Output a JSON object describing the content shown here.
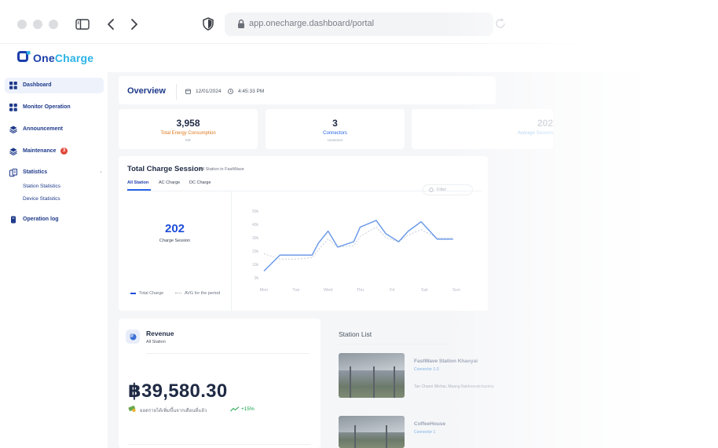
{
  "browser": {
    "url": "app.onecharge.dashboard/portal",
    "icons": [
      "sidebar-toggle-icon",
      "back-chevron-icon",
      "forward-chevron-icon",
      "shield-icon",
      "lock-icon",
      "reload-icon"
    ]
  },
  "brand": {
    "name_part1": "One",
    "name_part2": "Charge",
    "accent": "#1c3faa",
    "accent2": "#2bb3e6"
  },
  "sidebar": {
    "items": [
      {
        "label": "Dashboard",
        "icon": "grid-icon"
      },
      {
        "label": "Monitor Operation",
        "icon": "grid-icon"
      },
      {
        "label": "Announcement",
        "icon": "layers-icon"
      },
      {
        "label": "Maintenance",
        "icon": "layers-icon",
        "badge": "3"
      },
      {
        "label": "Statistics",
        "icon": "stats-icon"
      },
      {
        "label": "Operation log",
        "icon": "doc-icon"
      }
    ],
    "statistics_sub": [
      "Station Statistics",
      "Device Statistics"
    ]
  },
  "overview": {
    "title": "Overview",
    "date": "12/01/2024",
    "time": "4:45:33 PM"
  },
  "stats": [
    {
      "value": "3,958",
      "label": "Total Energy Consumption",
      "unit": "kW",
      "color": "#e07a1f"
    },
    {
      "value": "3",
      "label": "Connectors",
      "unit": "connector",
      "color": "#2563eb"
    },
    {
      "value": "202",
      "label": "Average Session",
      "unit": "",
      "color": "#7fb2e6"
    }
  ],
  "sessions": {
    "title": "Total Charge Session",
    "subtitle": "All Station in FastWave",
    "tabs": [
      "All Station",
      "AC Charge",
      "DC Charge"
    ],
    "filter_label": "Filter",
    "count": "202",
    "count_label": "Charge Session",
    "legend_total": "Total Charge",
    "legend_avg": "AVG for the period"
  },
  "chart_data": {
    "type": "line",
    "categories": [
      "Mon",
      "Tue",
      "Wed",
      "Thu",
      "Fri",
      "Sat",
      "Sun"
    ],
    "y_ticks": [
      "50k",
      "40k",
      "30k",
      "20k",
      "10k",
      "0k"
    ],
    "ylim": [
      0,
      50000
    ],
    "x": [
      0,
      0.5,
      1,
      1.5,
      1.7,
      2,
      2.3,
      2.8,
      3,
      3.5,
      3.8,
      4.2,
      4.5,
      4.9,
      5.4,
      5.9
    ],
    "series": [
      {
        "name": "Total Charge",
        "values": [
          5000,
          17000,
          17000,
          17000,
          26000,
          35000,
          23000,
          27000,
          38000,
          43000,
          33000,
          27000,
          35000,
          42000,
          29000,
          29000
        ]
      },
      {
        "name": "AVG for the period",
        "values": [
          18000,
          14000,
          14000,
          15000,
          21000,
          29000,
          23000,
          24000,
          31000,
          38000,
          30000,
          27000,
          32000,
          36000,
          30000,
          30000
        ]
      }
    ],
    "colors": {
      "total": "#6d9be8",
      "avg": "#c9cdd6"
    }
  },
  "revenue": {
    "title": "Revenue",
    "subtitle": "All Station",
    "amount": "฿39,580.30",
    "note": "ยอดรายได้เพิ่มขึ้นจากเดือนที่แล้ว",
    "change": "+15%"
  },
  "station_list": {
    "title": "Station List",
    "stations": [
      {
        "name": "FastWave Station Khaoyai",
        "connectors": "Connector 1-3",
        "address": "Tan Charoi Wichai, Muang Nakhonratchasima"
      },
      {
        "name": "CoffeeHouse",
        "connectors": "Connector 1",
        "address": ""
      }
    ]
  }
}
